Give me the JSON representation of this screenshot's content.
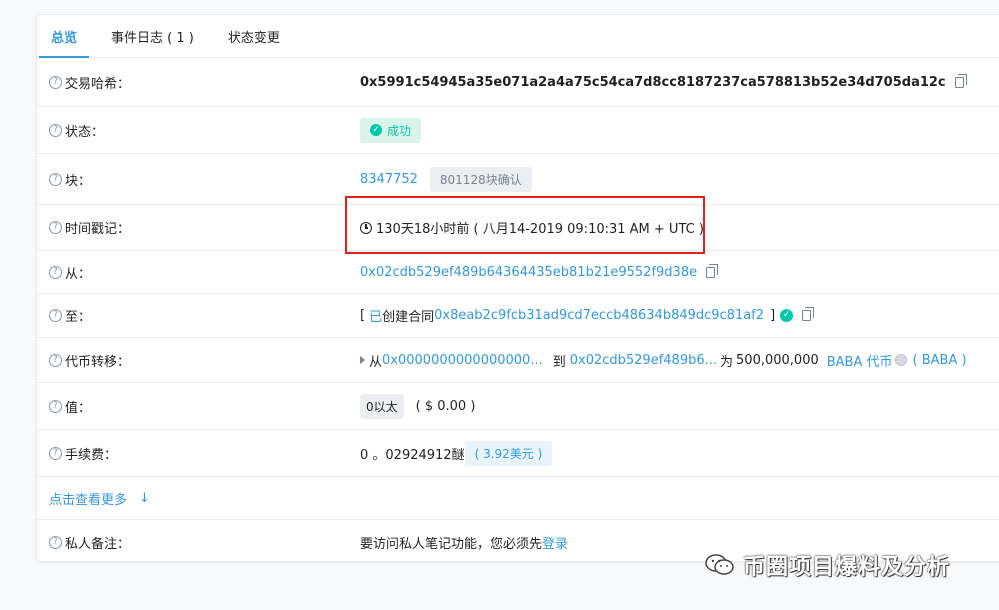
{
  "tabs": [
    {
      "label": "总览"
    },
    {
      "label": "事件日志 ( 1 )"
    },
    {
      "label": "状态变更"
    }
  ],
  "rows": {
    "tx_hash": {
      "label": "交易哈希：",
      "value": "0x5991c54945a35e071a2a4a75c54ca7d8cc8187237ca578813b52e34d705da12c"
    },
    "status": {
      "label": "状态：",
      "value": "成功"
    },
    "block": {
      "label": "块：",
      "number": "8347752",
      "confirmations": "801128块确认"
    },
    "timestamp": {
      "label": "时间戳记：",
      "value": "130天18小时前 ( 八月14-2019 09:10:31 AM + UTC )"
    },
    "from": {
      "label": "从：",
      "value": "0x02cdb529ef489b64364435eb81b21e9552f9d38e"
    },
    "to": {
      "label": "至：",
      "prefix": "[",
      "contract_word": "已",
      "created_text": " 创建合同",
      "address": "0x8eab2c9fcb31ad9cd7eccb48634b849dc9c81af2",
      "suffix": "]"
    },
    "token_transfer": {
      "label": "代币转移：",
      "from_word": "从",
      "from_addr": "0x0000000000000000...",
      "to_word": "到",
      "to_addr": "0x02cdb529ef489b6...",
      "for_word": "为",
      "amount": "500,000,000",
      "token_name": "BABA 代币",
      "token_symbol": "( BABA )"
    },
    "value": {
      "label": "值：",
      "eth": "0以太",
      "usd": "( $ 0.00 )"
    },
    "fee": {
      "label": "手续费：",
      "value": "0 。02924912醚",
      "usd": "( 3.92美元 )"
    },
    "more": {
      "label": "点击查看更多",
      "arrow": "↓"
    },
    "note": {
      "label": "私人备注：",
      "text": "要访问私人笔记功能，您必须先",
      "login": "登录"
    }
  },
  "watermark": {
    "text": "币圈项目爆料及分析"
  },
  "colors": {
    "link": "#3498db",
    "success": "#00c9a7",
    "highlight": "#e02020"
  }
}
